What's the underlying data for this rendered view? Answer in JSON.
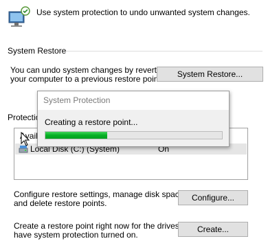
{
  "header": {
    "icon": "computer-shield-icon",
    "intro_text": "Use system protection to undo unwanted system changes."
  },
  "system_restore": {
    "title": "System Restore",
    "description_line1": "You can undo system changes by reverting",
    "description_line2": "your computer to a previous restore point.",
    "button_label": "System Restore..."
  },
  "protection": {
    "title_visible": "Protection",
    "column_available": "Availa",
    "drive_icon": "local-disk-icon",
    "drive_name": "Local Disk (C:) (System)",
    "drive_status": "On"
  },
  "configure": {
    "description_line1": "Configure restore settings, manage disk space,",
    "description_line2": "and delete restore points.",
    "button_label": "Configure..."
  },
  "create": {
    "description_line1": "Create a restore point right now for the drives that",
    "description_line2": "have system protection turned on.",
    "button_label": "Create..."
  },
  "dialog": {
    "title": "System Protection",
    "message": "Creating a restore point...",
    "progress_fraction": 0.35,
    "progress_color": "#06b025"
  },
  "colors": {
    "button_bg": "#e1e1e1",
    "selected_row_bg": "#e5e5e5",
    "dialog_bg": "#f0f0f0"
  }
}
